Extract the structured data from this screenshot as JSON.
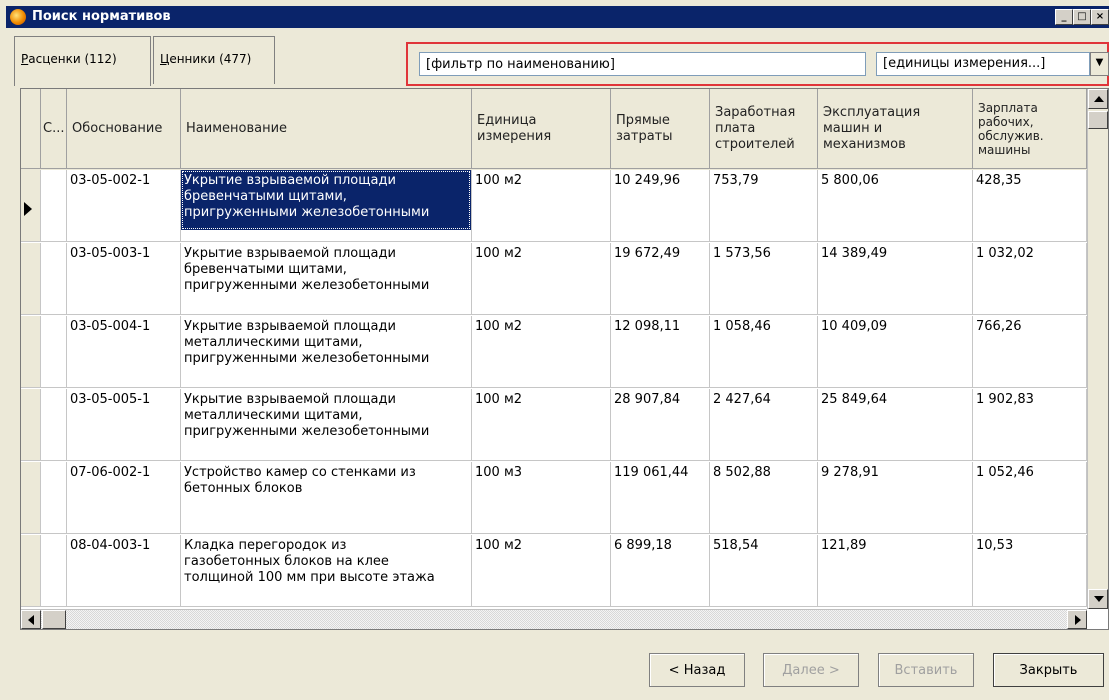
{
  "window": {
    "title": "Поиск нормативов",
    "minimize": "_",
    "maximize": "□",
    "close": "×"
  },
  "tabs": [
    {
      "label_pre": "",
      "label_ul": "Р",
      "label_post": "асценки (112)"
    },
    {
      "label_pre": "",
      "label_ul": "Ц",
      "label_post": "енники (477)"
    }
  ],
  "filter": {
    "name_value": "[фильтр по наименованию]",
    "units_value": "[единицы измерения...]"
  },
  "table": {
    "columns": [
      "С...",
      "Обоснование",
      "Наименование",
      "Единица\nизмерения",
      "Прямые\nзатраты",
      "Заработная\nплата\nстроителей",
      "Эксплуатация\nмашин и\nмеханизмов",
      "Зарплата\nрабочих,\nобслужив.\nмашины"
    ],
    "rows": [
      [
        "",
        "03-05-002-1",
        "Укрытие взрываемой площади\nбревенчатыми щитами,\nпригруженными железобетонными",
        "100 м2",
        "10 249,96",
        "753,79",
        "5 800,06",
        "428,35"
      ],
      [
        "",
        "03-05-003-1",
        "Укрытие взрываемой площади\nбревенчатыми щитами,\nпригруженными железобетонными",
        "100 м2",
        "19 672,49",
        "1 573,56",
        "14 389,49",
        "1 032,02"
      ],
      [
        "",
        "03-05-004-1",
        "Укрытие взрываемой площади\nметаллическими щитами,\nпригруженными железобетонными",
        "100 м2",
        "12 098,11",
        "1 058,46",
        "10 409,09",
        "766,26"
      ],
      [
        "",
        "03-05-005-1",
        "Укрытие взрываемой площади\nметаллическими щитами,\nпригруженными железобетонными",
        "100 м2",
        "28 907,84",
        "2 427,64",
        "25 849,64",
        "1 902,83"
      ],
      [
        "",
        "07-06-002-1",
        "Устройство камер со стенками из\nбетонных блоков",
        "100 м3",
        "119 061,44",
        "8 502,88",
        "9 278,91",
        "1 052,46"
      ],
      [
        "",
        "08-04-003-1",
        "Кладка перегородок из\nгазобетонных блоков на клее\nтолщиной 100 мм при высоте этажа",
        "100 м2",
        "6 899,18",
        "518,54",
        "121,89",
        "10,53"
      ]
    ]
  },
  "buttons": {
    "back": "< Назад",
    "next": "Далее >",
    "insert": "Вставить",
    "close": "Закрыть"
  }
}
